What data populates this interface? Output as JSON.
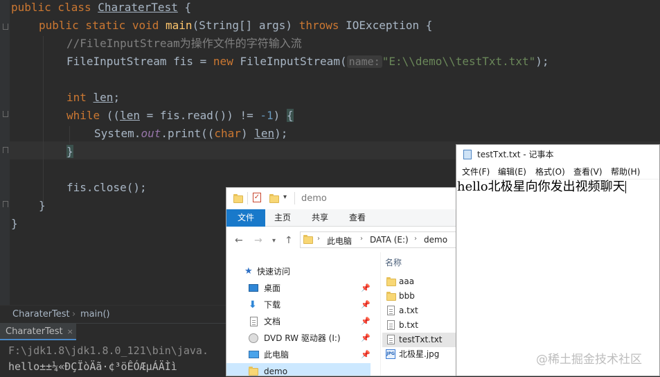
{
  "ide": {
    "code": {
      "l1_kw": "public class ",
      "l1_name": "CharaterTest",
      "l1_end": " {",
      "l2_kw": "public static void ",
      "l2_fn": "main",
      "l2_args": "(String[] args) ",
      "l2_throws": "throws ",
      "l2_exc": "IOException {",
      "l3_comment": "//FileInputStream为操作文件的字符输入流",
      "l4_a": "FileInputStream fis = ",
      "l4_new": "new ",
      "l4_b": "FileInputStream(",
      "l4_hint": "name:",
      "l4_str": "\"E:\\\\demo\\\\testTxt.txt\"",
      "l4_end": ");",
      "l6_kw": "int ",
      "l6_var": "len",
      "l6_end": ";",
      "l7_kw": "while ",
      "l7_a": "((",
      "l7_var": "len",
      "l7_b": " = fis.read()) != ",
      "l7_num": "-1",
      "l7_c": ") ",
      "l7_brace": "{",
      "l8_a": "System.",
      "l8_out": "out",
      "l8_b": ".print((",
      "l8_kw": "char",
      "l8_c": ") ",
      "l8_var": "len",
      "l8_d": ");",
      "l9_brace": "}",
      "l11": "fis.close();",
      "l12": "}",
      "l13": "}"
    },
    "breadcrumb": {
      "class": "CharaterTest",
      "method": "main()"
    },
    "run": {
      "tab_label": "CharaterTest",
      "tab_close": "×",
      "cmd": "F:\\jdk1.8\\jdk1.8.0_121\\bin\\java.",
      "output": "hello±±¼«ÐÇÏòÄã·¢³öÊÓÆµÁÄÌì"
    }
  },
  "explorer": {
    "title": "demo",
    "ribbon_tabs": [
      "文件",
      "主页",
      "共享",
      "查看"
    ],
    "address": [
      "此电脑",
      "DATA (E:)",
      "demo"
    ],
    "nav": [
      {
        "label": "快速访问",
        "icon": "star-icon",
        "pinned": false
      },
      {
        "label": "桌面",
        "icon": "desktop-icon",
        "pinned": true
      },
      {
        "label": "下载",
        "icon": "download-icon",
        "pinned": true
      },
      {
        "label": "文档",
        "icon": "document-icon",
        "pinned": true
      },
      {
        "label": "DVD RW 驱动器 (I:)",
        "icon": "dvd-icon",
        "pinned": true
      },
      {
        "label": "此电脑",
        "icon": "computer-icon",
        "pinned": true
      },
      {
        "label": "demo",
        "icon": "folder-icon",
        "pinned": false
      }
    ],
    "column_header": "名称",
    "files": [
      {
        "name": "aaa",
        "type": "folder"
      },
      {
        "name": "bbb",
        "type": "folder"
      },
      {
        "name": "a.txt",
        "type": "txt"
      },
      {
        "name": "b.txt",
        "type": "txt"
      },
      {
        "name": "testTxt.txt",
        "type": "txt"
      },
      {
        "name": "北极星.jpg",
        "type": "jpg"
      }
    ],
    "jpg_badge": "JPG",
    "pin_glyph": "📌"
  },
  "notepad": {
    "title": "testTxt.txt - 记事本",
    "menu": [
      "文件(F)",
      "编辑(E)",
      "格式(O)",
      "查看(V)",
      "帮助(H)"
    ],
    "content": "hello北极星向你发出视频聊天"
  },
  "watermark": "@稀土掘金技术社区",
  "colors": {
    "ide_bg": "#2b2b2b",
    "keyword": "#cc7832",
    "function": "#ffc66d",
    "string": "#6a8759",
    "number": "#6897bb",
    "explorer_accent": "#1979ca"
  }
}
